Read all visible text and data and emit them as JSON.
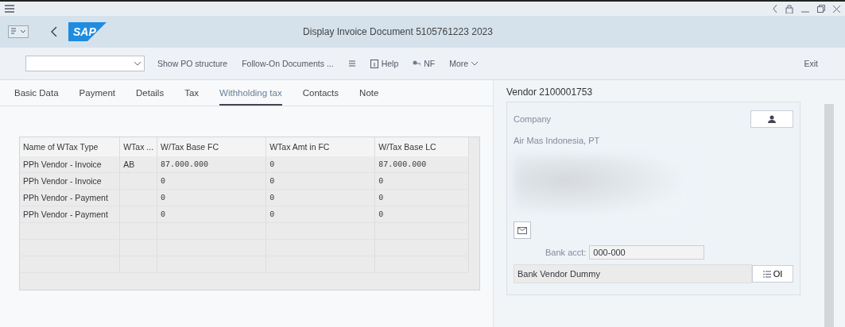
{
  "logo": "SAP",
  "window": {
    "title": "Display Invoice Document 5105761223 2023"
  },
  "toolbar": {
    "items": [
      {
        "label": "Show PO structure",
        "kind": "text"
      },
      {
        "label": "Follow-On Documents ...",
        "kind": "text"
      },
      {
        "kind": "list-icon"
      },
      {
        "label": "Help",
        "kind": "help"
      },
      {
        "label": "NF",
        "kind": "nf"
      },
      {
        "label": "More",
        "kind": "menu"
      }
    ],
    "exit": "Exit"
  },
  "tabs": [
    {
      "label": "Basic Data",
      "selected": false
    },
    {
      "label": "Payment",
      "selected": false
    },
    {
      "label": "Details",
      "selected": false
    },
    {
      "label": "Tax",
      "selected": false
    },
    {
      "label": "Withholding tax",
      "selected": true
    },
    {
      "label": "Contacts",
      "selected": false
    },
    {
      "label": "Note",
      "selected": false
    }
  ],
  "table": {
    "columns": [
      "Name of WTax Type",
      "WTax ...",
      "W/Tax Base FC",
      "WTax Amt in FC",
      "W/Tax Base LC"
    ],
    "rows": [
      [
        "PPh Vendor - Invoice",
        "AB",
        "87.000.000",
        "0",
        "87.000.000"
      ],
      [
        "PPh Vendor - Invoice",
        "",
        "0",
        "0",
        "0"
      ],
      [
        "PPh Vendor - Payment",
        "",
        "0",
        "0",
        "0"
      ],
      [
        "PPh Vendor - Payment",
        "",
        "0",
        "0",
        "0"
      ]
    ]
  },
  "vendor": {
    "title": "Vendor 2100001753",
    "label": "Company",
    "name": "Air Mas Indonesia, PT",
    "bank_label": "Bank acct:",
    "bank_value": "000-000",
    "bank_name": "Bank Vendor Dummy",
    "bank_button": "OI"
  }
}
